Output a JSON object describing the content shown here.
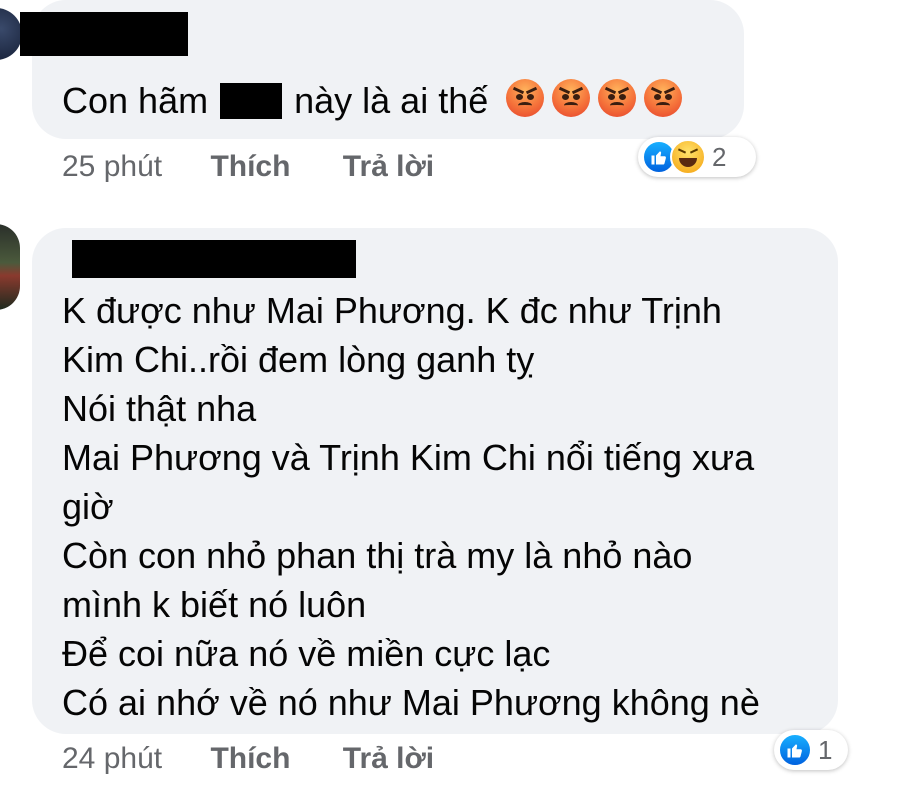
{
  "comments": [
    {
      "text_before": "Con hãm",
      "text_after": "này là ai thế",
      "emojis": [
        "angry-face-icon",
        "angry-face-icon",
        "angry-face-icon",
        "angry-face-icon"
      ],
      "time": "25 phút",
      "like_label": "Thích",
      "reply_label": "Trả lời",
      "reactions": [
        "like-icon",
        "haha-icon"
      ],
      "reaction_count": "2"
    },
    {
      "lines": [
        "K được như Mai Phương. K đc như Trịnh",
        "Kim Chi..rồi đem lòng ganh tỵ",
        "Nói thật nha",
        "Mai Phương và Trịnh Kim Chi nổi tiếng xưa",
        "giờ",
        "Còn con nhỏ phan thị trà my là nhỏ nào",
        "mình k biết nó luôn",
        "Để coi nữa nó về miền cực lạc",
        "Có ai nhớ về nó như Mai Phương không nè"
      ],
      "time": "24 phút",
      "like_label": "Thích",
      "reply_label": "Trả lời",
      "reactions": [
        "like-icon"
      ],
      "reaction_count": "1"
    }
  ],
  "colors": {
    "bubble": "#f0f2f5",
    "meta": "#65676b",
    "like": "#0866ff"
  }
}
